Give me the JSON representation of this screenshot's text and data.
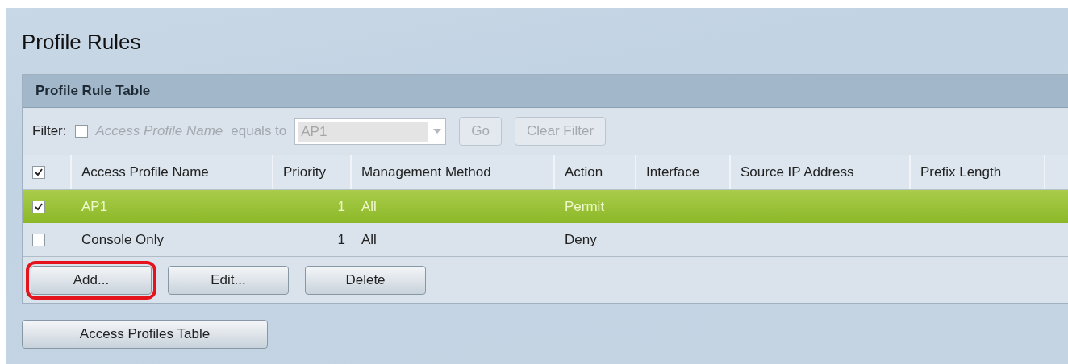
{
  "page": {
    "title": "Profile Rules"
  },
  "table": {
    "title": "Profile Rule Table",
    "filter": {
      "label": "Filter:",
      "checked": false,
      "field": "Access Profile Name",
      "operator": "equals to",
      "value": "AP1",
      "disabled": true,
      "buttons": [
        {
          "label": "Go",
          "disabled": true
        },
        {
          "label": "Clear Filter",
          "disabled": true
        }
      ]
    },
    "select_all": {
      "checked": true
    },
    "columns": [
      "Access Profile Name",
      "Priority",
      "Management Method",
      "Action",
      "Interface",
      "Source IP Address",
      "Prefix Length"
    ],
    "rows": [
      {
        "selected": true,
        "checked": true,
        "cells": [
          "AP1",
          "1",
          "All",
          "Permit",
          "",
          "",
          ""
        ]
      },
      {
        "selected": false,
        "checked": false,
        "cells": [
          "Console Only",
          "1",
          "All",
          "Deny",
          "",
          "",
          ""
        ]
      }
    ],
    "buttons": [
      {
        "label": "Add...",
        "highlighted": true
      },
      {
        "label": "Edit...",
        "highlighted": false
      },
      {
        "label": "Delete",
        "highlighted": false
      }
    ]
  },
  "footer_buttons": [
    {
      "label": "Access Profiles Table"
    }
  ]
}
